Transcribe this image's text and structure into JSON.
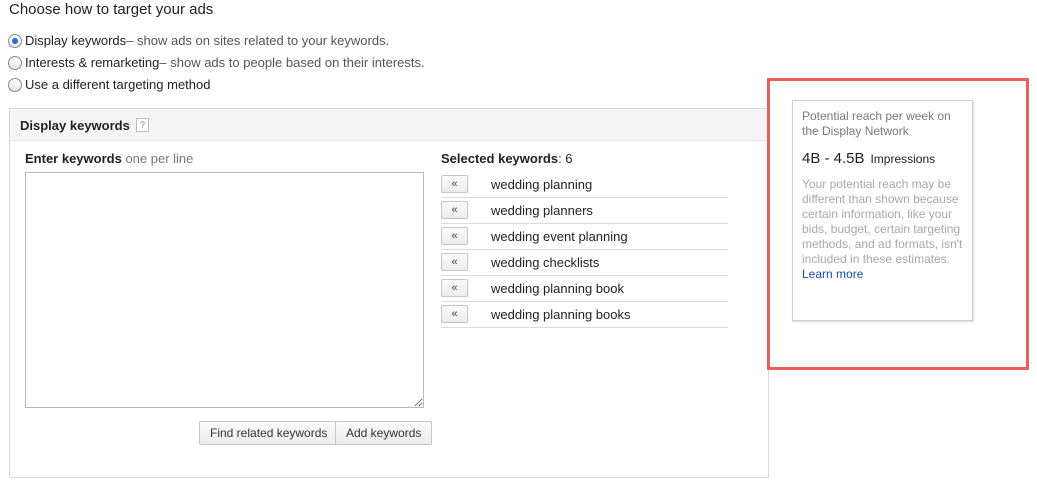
{
  "page": {
    "title": "Choose how to target your ads"
  },
  "targeting_options": [
    {
      "label": "Display keywords",
      "description": " – show ads on sites related to your keywords.",
      "checked": true
    },
    {
      "label": "Interests & remarketing",
      "description": " – show ads to people based on their interests.",
      "checked": false
    },
    {
      "label": "Use a different targeting method",
      "description": "",
      "checked": false
    }
  ],
  "panel": {
    "title": "Display keywords",
    "help_icon": "?",
    "enter_label": "Enter keywords",
    "enter_hint": "one per line",
    "textarea_value": "",
    "find_button": "Find related keywords",
    "add_button": "Add keywords",
    "selected_label": "Selected keywords",
    "selected_count": ": 6",
    "remove_icon": "«",
    "keywords": [
      "wedding planning",
      "wedding planners",
      "wedding event planning",
      "wedding checklists",
      "wedding planning book",
      "wedding planning books"
    ]
  },
  "reach": {
    "title": "Potential reach per week on the Display Network",
    "value": "4B - 4.5B",
    "unit": "Impressions",
    "note": "Your potential reach may be different than shown because certain information, like your bids, budget, certain targeting methods, and ad formats, isn't included in these estimates.",
    "link": "Learn more"
  },
  "colors": {
    "highlight": "#e8605a",
    "link": "#1a4bb3",
    "radio_selected": "#2a6cd6"
  }
}
